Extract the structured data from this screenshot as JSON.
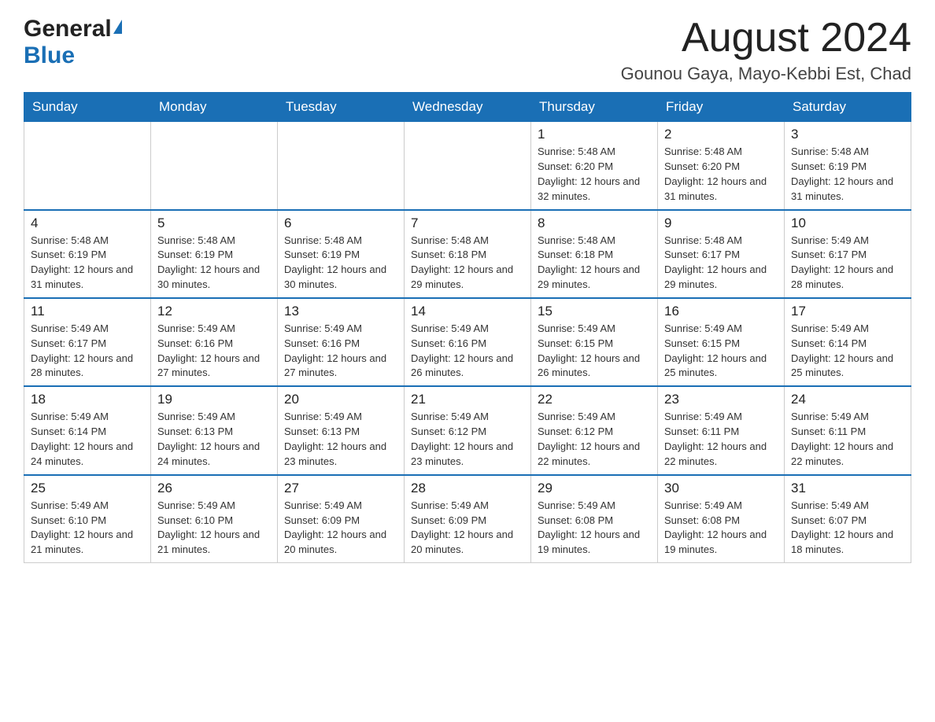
{
  "header": {
    "logo_general": "General",
    "logo_blue": "Blue",
    "month_title": "August 2024",
    "subtitle": "Gounou Gaya, Mayo-Kebbi Est, Chad"
  },
  "weekdays": [
    "Sunday",
    "Monday",
    "Tuesday",
    "Wednesday",
    "Thursday",
    "Friday",
    "Saturday"
  ],
  "weeks": [
    [
      {
        "day": "",
        "info": ""
      },
      {
        "day": "",
        "info": ""
      },
      {
        "day": "",
        "info": ""
      },
      {
        "day": "",
        "info": ""
      },
      {
        "day": "1",
        "info": "Sunrise: 5:48 AM\nSunset: 6:20 PM\nDaylight: 12 hours and 32 minutes."
      },
      {
        "day": "2",
        "info": "Sunrise: 5:48 AM\nSunset: 6:20 PM\nDaylight: 12 hours and 31 minutes."
      },
      {
        "day": "3",
        "info": "Sunrise: 5:48 AM\nSunset: 6:19 PM\nDaylight: 12 hours and 31 minutes."
      }
    ],
    [
      {
        "day": "4",
        "info": "Sunrise: 5:48 AM\nSunset: 6:19 PM\nDaylight: 12 hours and 31 minutes."
      },
      {
        "day": "5",
        "info": "Sunrise: 5:48 AM\nSunset: 6:19 PM\nDaylight: 12 hours and 30 minutes."
      },
      {
        "day": "6",
        "info": "Sunrise: 5:48 AM\nSunset: 6:19 PM\nDaylight: 12 hours and 30 minutes."
      },
      {
        "day": "7",
        "info": "Sunrise: 5:48 AM\nSunset: 6:18 PM\nDaylight: 12 hours and 29 minutes."
      },
      {
        "day": "8",
        "info": "Sunrise: 5:48 AM\nSunset: 6:18 PM\nDaylight: 12 hours and 29 minutes."
      },
      {
        "day": "9",
        "info": "Sunrise: 5:48 AM\nSunset: 6:17 PM\nDaylight: 12 hours and 29 minutes."
      },
      {
        "day": "10",
        "info": "Sunrise: 5:49 AM\nSunset: 6:17 PM\nDaylight: 12 hours and 28 minutes."
      }
    ],
    [
      {
        "day": "11",
        "info": "Sunrise: 5:49 AM\nSunset: 6:17 PM\nDaylight: 12 hours and 28 minutes."
      },
      {
        "day": "12",
        "info": "Sunrise: 5:49 AM\nSunset: 6:16 PM\nDaylight: 12 hours and 27 minutes."
      },
      {
        "day": "13",
        "info": "Sunrise: 5:49 AM\nSunset: 6:16 PM\nDaylight: 12 hours and 27 minutes."
      },
      {
        "day": "14",
        "info": "Sunrise: 5:49 AM\nSunset: 6:16 PM\nDaylight: 12 hours and 26 minutes."
      },
      {
        "day": "15",
        "info": "Sunrise: 5:49 AM\nSunset: 6:15 PM\nDaylight: 12 hours and 26 minutes."
      },
      {
        "day": "16",
        "info": "Sunrise: 5:49 AM\nSunset: 6:15 PM\nDaylight: 12 hours and 25 minutes."
      },
      {
        "day": "17",
        "info": "Sunrise: 5:49 AM\nSunset: 6:14 PM\nDaylight: 12 hours and 25 minutes."
      }
    ],
    [
      {
        "day": "18",
        "info": "Sunrise: 5:49 AM\nSunset: 6:14 PM\nDaylight: 12 hours and 24 minutes."
      },
      {
        "day": "19",
        "info": "Sunrise: 5:49 AM\nSunset: 6:13 PM\nDaylight: 12 hours and 24 minutes."
      },
      {
        "day": "20",
        "info": "Sunrise: 5:49 AM\nSunset: 6:13 PM\nDaylight: 12 hours and 23 minutes."
      },
      {
        "day": "21",
        "info": "Sunrise: 5:49 AM\nSunset: 6:12 PM\nDaylight: 12 hours and 23 minutes."
      },
      {
        "day": "22",
        "info": "Sunrise: 5:49 AM\nSunset: 6:12 PM\nDaylight: 12 hours and 22 minutes."
      },
      {
        "day": "23",
        "info": "Sunrise: 5:49 AM\nSunset: 6:11 PM\nDaylight: 12 hours and 22 minutes."
      },
      {
        "day": "24",
        "info": "Sunrise: 5:49 AM\nSunset: 6:11 PM\nDaylight: 12 hours and 22 minutes."
      }
    ],
    [
      {
        "day": "25",
        "info": "Sunrise: 5:49 AM\nSunset: 6:10 PM\nDaylight: 12 hours and 21 minutes."
      },
      {
        "day": "26",
        "info": "Sunrise: 5:49 AM\nSunset: 6:10 PM\nDaylight: 12 hours and 21 minutes."
      },
      {
        "day": "27",
        "info": "Sunrise: 5:49 AM\nSunset: 6:09 PM\nDaylight: 12 hours and 20 minutes."
      },
      {
        "day": "28",
        "info": "Sunrise: 5:49 AM\nSunset: 6:09 PM\nDaylight: 12 hours and 20 minutes."
      },
      {
        "day": "29",
        "info": "Sunrise: 5:49 AM\nSunset: 6:08 PM\nDaylight: 12 hours and 19 minutes."
      },
      {
        "day": "30",
        "info": "Sunrise: 5:49 AM\nSunset: 6:08 PM\nDaylight: 12 hours and 19 minutes."
      },
      {
        "day": "31",
        "info": "Sunrise: 5:49 AM\nSunset: 6:07 PM\nDaylight: 12 hours and 18 minutes."
      }
    ]
  ]
}
